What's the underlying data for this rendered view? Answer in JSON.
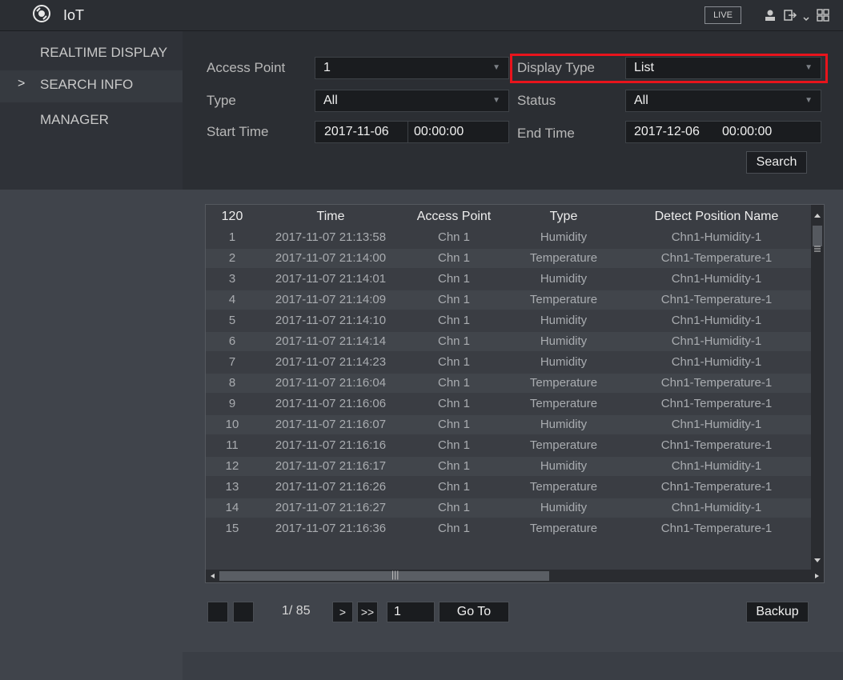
{
  "colors": {
    "highlight": "#e8141c",
    "panel": "#2b2e33",
    "table_bg": "#3a3d43"
  },
  "header": {
    "app_title": "IoT",
    "live_label": "LIVE",
    "icons": [
      "camera-lens-logo",
      "user-icon",
      "logout-icon",
      "menu-grid-icon"
    ]
  },
  "sidebar": {
    "items": [
      {
        "label": "REALTIME DISPLAY",
        "active": false
      },
      {
        "label": "SEARCH INFO",
        "active": true,
        "marker": ">"
      },
      {
        "label": "MANAGER",
        "active": false
      }
    ]
  },
  "filters": {
    "access_point": {
      "label": "Access Point",
      "value": "1"
    },
    "display_type": {
      "label": "Display Type",
      "value": "List"
    },
    "type": {
      "label": "Type",
      "value": "All"
    },
    "status": {
      "label": "Status",
      "value": "All"
    },
    "start_time": {
      "label": "Start Time",
      "date": "2017-11-06",
      "time": "00:00:00"
    },
    "end_time": {
      "label": "End Time",
      "date": "2017-12-06",
      "time": "00:00:00"
    },
    "search_label": "Search"
  },
  "table": {
    "headers": [
      "120",
      "Time",
      "Access Point",
      "Type",
      "Detect Position Name"
    ],
    "rows": [
      [
        "1",
        "2017-11-07 21:13:58",
        "Chn 1",
        "Humidity",
        "Chn1-Humidity-1"
      ],
      [
        "2",
        "2017-11-07 21:14:00",
        "Chn 1",
        "Temperature",
        "Chn1-Temperature-1"
      ],
      [
        "3",
        "2017-11-07 21:14:01",
        "Chn 1",
        "Humidity",
        "Chn1-Humidity-1"
      ],
      [
        "4",
        "2017-11-07 21:14:09",
        "Chn 1",
        "Temperature",
        "Chn1-Temperature-1"
      ],
      [
        "5",
        "2017-11-07 21:14:10",
        "Chn 1",
        "Humidity",
        "Chn1-Humidity-1"
      ],
      [
        "6",
        "2017-11-07 21:14:14",
        "Chn 1",
        "Humidity",
        "Chn1-Humidity-1"
      ],
      [
        "7",
        "2017-11-07 21:14:23",
        "Chn 1",
        "Humidity",
        "Chn1-Humidity-1"
      ],
      [
        "8",
        "2017-11-07 21:16:04",
        "Chn 1",
        "Temperature",
        "Chn1-Temperature-1"
      ],
      [
        "9",
        "2017-11-07 21:16:06",
        "Chn 1",
        "Temperature",
        "Chn1-Temperature-1"
      ],
      [
        "10",
        "2017-11-07 21:16:07",
        "Chn 1",
        "Humidity",
        "Chn1-Humidity-1"
      ],
      [
        "11",
        "2017-11-07 21:16:16",
        "Chn 1",
        "Temperature",
        "Chn1-Temperature-1"
      ],
      [
        "12",
        "2017-11-07 21:16:17",
        "Chn 1",
        "Humidity",
        "Chn1-Humidity-1"
      ],
      [
        "13",
        "2017-11-07 21:16:26",
        "Chn 1",
        "Temperature",
        "Chn1-Temperature-1"
      ],
      [
        "14",
        "2017-11-07 21:16:27",
        "Chn 1",
        "Humidity",
        "Chn1-Humidity-1"
      ],
      [
        "15",
        "2017-11-07 21:16:36",
        "Chn 1",
        "Temperature",
        "Chn1-Temperature-1"
      ]
    ]
  },
  "pager": {
    "prev_label": "",
    "first_label": "",
    "page_info": "1/ 85",
    "next_label": ">",
    "last_label": ">>",
    "page_input": "1",
    "goto_label": "Go To",
    "backup_label": "Backup"
  }
}
